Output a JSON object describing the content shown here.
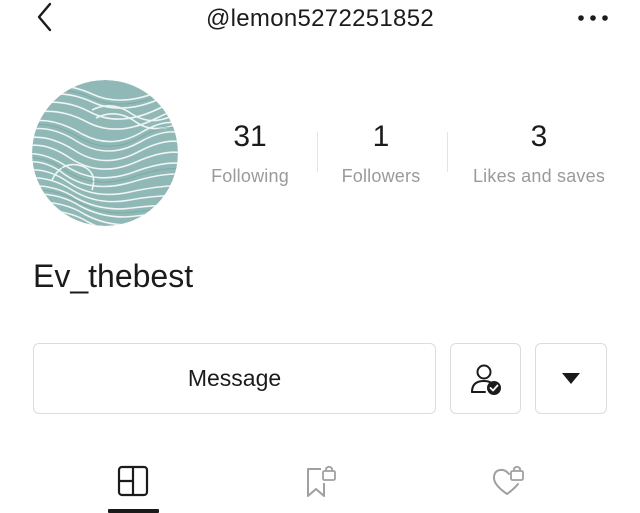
{
  "header": {
    "handle": "@lemon5272251852",
    "back_icon": "chevron-left-icon",
    "more_icon": "more-horizontal-icon"
  },
  "profile": {
    "avatar_icon": "wave-pattern-avatar",
    "username": "Ev_thebest",
    "stats": [
      {
        "value": "31",
        "label": "Following"
      },
      {
        "value": "1",
        "label": "Followers"
      },
      {
        "value": "3",
        "label": "Likes and saves"
      }
    ]
  },
  "actions": {
    "message_label": "Message",
    "follow_icon": "user-check-icon",
    "dropdown_icon": "triangle-down-icon"
  },
  "tabs": [
    {
      "icon": "grid-layout-icon",
      "active": true
    },
    {
      "icon": "locked-bookmark-icon",
      "active": false
    },
    {
      "icon": "locked-heart-icon",
      "active": false
    }
  ],
  "colors": {
    "text": "#1b1b1b",
    "muted": "#9a9a9a",
    "border": "#dcdcdc",
    "avatar": "#8fb8b6"
  }
}
